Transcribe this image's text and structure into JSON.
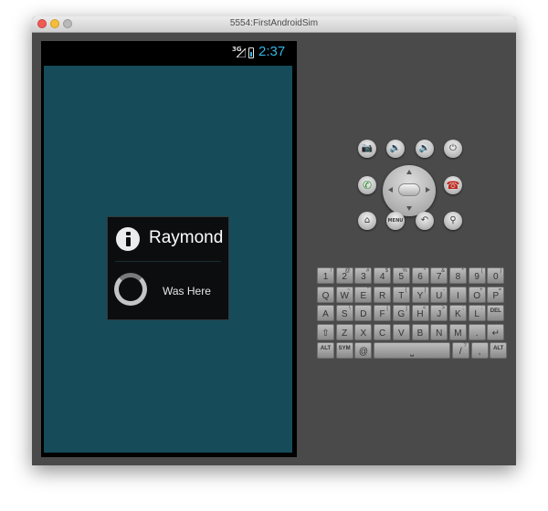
{
  "window": {
    "title": "5554:FirstAndroidSim"
  },
  "status_bar": {
    "network": "3G",
    "time": "2:37"
  },
  "dialog": {
    "title": "Raymond",
    "message": "Was Here"
  },
  "hardware": {
    "row1": [
      {
        "name": "camera-button",
        "icon": "📷",
        "cls": ""
      },
      {
        "name": "volume-down-button",
        "icon": "🔉",
        "cls": ""
      },
      {
        "name": "volume-up-button",
        "icon": "🔊",
        "cls": ""
      },
      {
        "name": "power-button",
        "icon": "⏻",
        "cls": ""
      }
    ],
    "call_icon": "✆",
    "end_icon": "☎",
    "row3": [
      {
        "name": "home-button",
        "icon": "⌂",
        "cls": ""
      },
      {
        "name": "menu-button",
        "icon": "MENU",
        "cls": "menu"
      },
      {
        "name": "back-button",
        "icon": "↶",
        "cls": ""
      },
      {
        "name": "search-button",
        "icon": "⚲",
        "cls": ""
      }
    ]
  },
  "keyboard": {
    "rows": [
      [
        {
          "m": "1",
          "s": "!"
        },
        {
          "m": "2",
          "s": "@"
        },
        {
          "m": "3",
          "s": "#"
        },
        {
          "m": "4",
          "s": "$"
        },
        {
          "m": "5",
          "s": "%"
        },
        {
          "m": "6",
          "s": "^"
        },
        {
          "m": "7",
          "s": "&"
        },
        {
          "m": "8",
          "s": "*"
        },
        {
          "m": "9",
          "s": "("
        },
        {
          "m": "0",
          "s": ")"
        }
      ],
      [
        {
          "m": "Q",
          "s": ""
        },
        {
          "m": "W",
          "s": "~"
        },
        {
          "m": "E",
          "s": "\""
        },
        {
          "m": "R",
          "s": ""
        },
        {
          "m": "T",
          "s": "{"
        },
        {
          "m": "Y",
          "s": "}"
        },
        {
          "m": "U",
          "s": "-"
        },
        {
          "m": "I",
          "s": ""
        },
        {
          "m": "O",
          "s": "+"
        },
        {
          "m": "P",
          "s": "="
        }
      ],
      [
        {
          "m": "A",
          "s": ""
        },
        {
          "m": "S",
          "s": "\\"
        },
        {
          "m": "D",
          "s": ""
        },
        {
          "m": "F",
          "s": "["
        },
        {
          "m": "G",
          "s": "]"
        },
        {
          "m": "H",
          "s": "<"
        },
        {
          "m": "J",
          "s": ">"
        },
        {
          "m": "K",
          "s": ";"
        },
        {
          "m": "L",
          "s": ":"
        },
        {
          "m": "DEL",
          "s": ""
        }
      ],
      [
        {
          "m": "⇧",
          "s": ""
        },
        {
          "m": "Z",
          "s": ""
        },
        {
          "m": "X",
          "s": ""
        },
        {
          "m": "C",
          "s": ""
        },
        {
          "m": "V",
          "s": ""
        },
        {
          "m": "B",
          "s": ""
        },
        {
          "m": "N",
          "s": ""
        },
        {
          "m": "M",
          "s": ""
        },
        {
          "m": ".",
          "s": ""
        },
        {
          "m": "↵",
          "s": ""
        }
      ],
      [
        {
          "m": "ALT",
          "s": ""
        },
        {
          "m": "SYM",
          "s": ""
        },
        {
          "m": "@",
          "s": ""
        },
        {
          "m": "⎵",
          "s": ""
        },
        {
          "m": "/",
          "s": "?"
        },
        {
          "m": ",",
          "s": ""
        },
        {
          "m": "ALT",
          "s": ""
        }
      ]
    ]
  }
}
